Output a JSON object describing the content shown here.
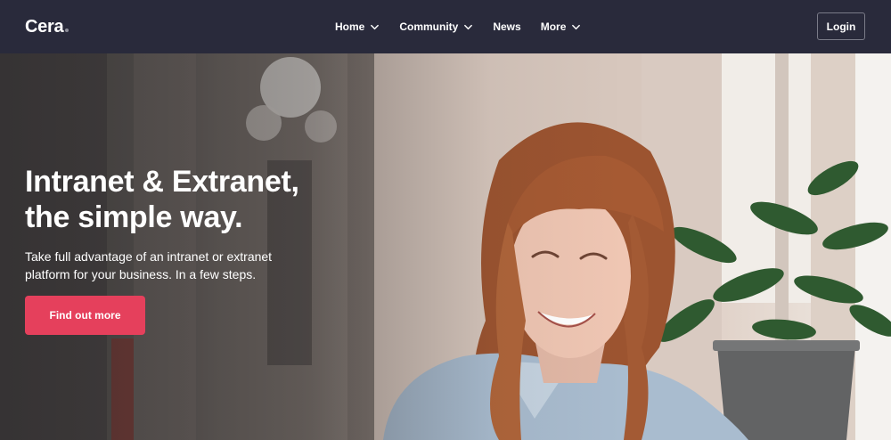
{
  "brand": {
    "name": "Cera"
  },
  "nav": {
    "items": [
      {
        "label": "Home",
        "has_dropdown": true
      },
      {
        "label": "Community",
        "has_dropdown": true
      },
      {
        "label": "News",
        "has_dropdown": false
      },
      {
        "label": "More",
        "has_dropdown": true
      }
    ],
    "login_label": "Login"
  },
  "hero": {
    "title_line1": "Intranet & Extranet,",
    "title_line2": "the simple way.",
    "subtitle_line1": "Take full advantage of an intranet or extranet",
    "subtitle_line2": "platform for your business. In a few steps.",
    "cta_label": "Find out more",
    "image": "photo of smiling woman with auburn hair in a light blue shirt beside a potted plant"
  },
  "colors": {
    "navbar_bg": "#292a3b",
    "accent": "#e5405c",
    "text_on_dark": "#ffffff"
  }
}
